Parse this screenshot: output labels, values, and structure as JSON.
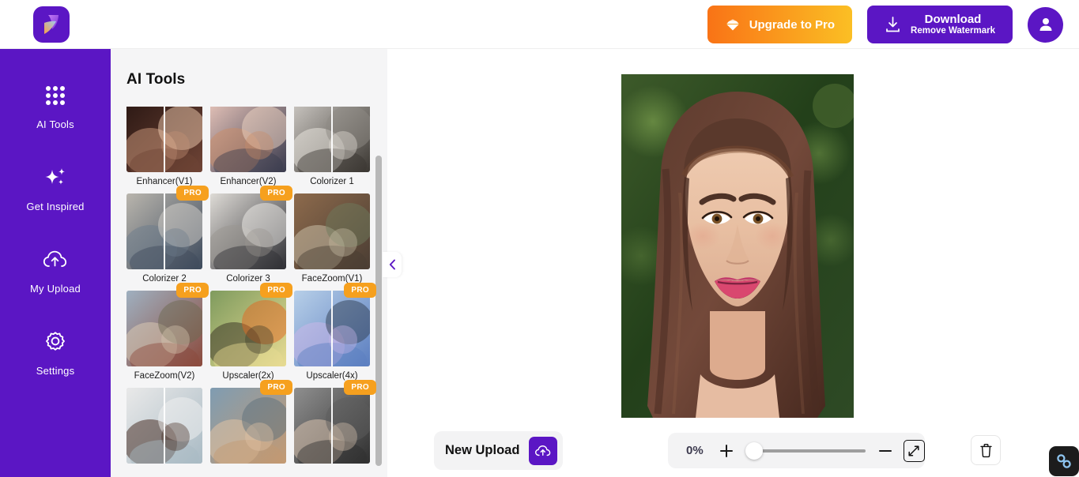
{
  "header": {
    "logo_name": "app-logo",
    "upgrade_label": "Upgrade to Pro",
    "download_title": "Download",
    "download_subtitle": "Remove Watermark",
    "avatar_name": "user-avatar"
  },
  "sidebar": {
    "items": [
      {
        "label": "AI Tools",
        "icon": "grid-dots-icon",
        "active": true
      },
      {
        "label": "Get Inspired",
        "icon": "sparkles-icon",
        "active": false
      },
      {
        "label": "My Upload",
        "icon": "cloud-upload-icon",
        "active": false
      },
      {
        "label": "Settings",
        "icon": "gear-icon",
        "active": false
      }
    ]
  },
  "tools_panel": {
    "title": "AI Tools",
    "collapse_icon": "chevron-left-icon",
    "pro_badge_label": "PRO",
    "tools": [
      {
        "label": "Enhancer(V1)",
        "pro": false,
        "thumb": "enhancer-v1-thumb",
        "split": true
      },
      {
        "label": "Enhancer(V2)",
        "pro": true,
        "thumb": "enhancer-v2-thumb",
        "split": false
      },
      {
        "label": "Colorizer 1",
        "pro": false,
        "thumb": "colorizer-1-thumb",
        "split": true
      },
      {
        "label": "Colorizer 2",
        "pro": true,
        "thumb": "colorizer-2-thumb",
        "split": true
      },
      {
        "label": "Colorizer 3",
        "pro": true,
        "thumb": "colorizer-3-thumb",
        "split": false
      },
      {
        "label": "FaceZoom(V1)",
        "pro": false,
        "thumb": "facezoom-v1-thumb",
        "split": false
      },
      {
        "label": "FaceZoom(V2)",
        "pro": true,
        "thumb": "facezoom-v2-thumb",
        "split": false
      },
      {
        "label": "Upscaler(2x)",
        "pro": true,
        "thumb": "upscaler-2x-thumb",
        "split": false
      },
      {
        "label": "Upscaler(4x)",
        "pro": true,
        "thumb": "upscaler-4x-thumb",
        "split": true
      },
      {
        "label": "",
        "pro": false,
        "thumb": "bg-remover-thumb",
        "split": true
      },
      {
        "label": "",
        "pro": true,
        "thumb": "branch-thumb",
        "split": false
      },
      {
        "label": "",
        "pro": true,
        "thumb": "denoise-thumb",
        "split": true
      }
    ]
  },
  "canvas": {
    "photo_name": "portrait-photo"
  },
  "bottom_bar": {
    "upload_label": "New Upload",
    "upload_icon": "cloud-upload-icon",
    "zoom_percent": "0%",
    "zoom_in_icon": "plus-icon",
    "zoom_out_icon": "minus-icon",
    "fit_icon": "expand-arrows-icon",
    "delete_icon": "trash-icon",
    "chain_icon": "link-chain-icon",
    "slider_value": 0
  },
  "colors": {
    "brand_purple": "#5b16c4",
    "pro_orange": "#f6a01e",
    "panel_grey": "#f5f5f6",
    "bar_grey": "#f3f3f4"
  }
}
